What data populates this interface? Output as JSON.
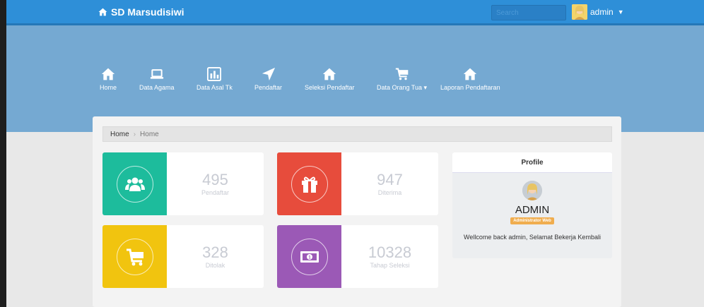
{
  "app": {
    "brand": "SD Marsudisiwi",
    "search_placeholder": "Search",
    "user_name": "admin"
  },
  "nav": {
    "items": [
      {
        "label": "Home",
        "icon": "home-icon"
      },
      {
        "label": "Data Agama",
        "icon": "laptop-icon"
      },
      {
        "label": "Data Asal Tk",
        "icon": "bar-chart-icon"
      },
      {
        "label": "Pendaftar",
        "icon": "location-arrow-icon"
      },
      {
        "label": "Seleksi Pendaftar",
        "icon": "home-icon"
      },
      {
        "label": "Data Orang Tua",
        "icon": "shopping-cart-icon",
        "has_dropdown": true
      },
      {
        "label": "Laporan Pendaftaran",
        "icon": "home-icon"
      }
    ]
  },
  "breadcrumb": {
    "root": "Home",
    "current": "Home"
  },
  "stats": [
    {
      "value": "495",
      "label": "Pendaftar",
      "color": "#1dbc9c",
      "icon": "users-icon"
    },
    {
      "value": "947",
      "label": "Diterima",
      "color": "#e74c3c",
      "icon": "gift-icon"
    },
    {
      "value": "328",
      "label": "Ditolak",
      "color": "#f1c40f",
      "icon": "shopping-cart-icon"
    },
    {
      "value": "10328",
      "label": "Tahap Seleksi",
      "color": "#9b59b6",
      "icon": "money-icon"
    }
  ],
  "profile": {
    "title": "Profile",
    "name": "ADMIN",
    "role": "Administrator Web",
    "welcome": "Wellcome back admin, Selamat Bekerja Kembali"
  },
  "colors": {
    "topbar": "#2e8fd8",
    "hero": "#75a9d2",
    "badge": "#f0ad4e"
  }
}
